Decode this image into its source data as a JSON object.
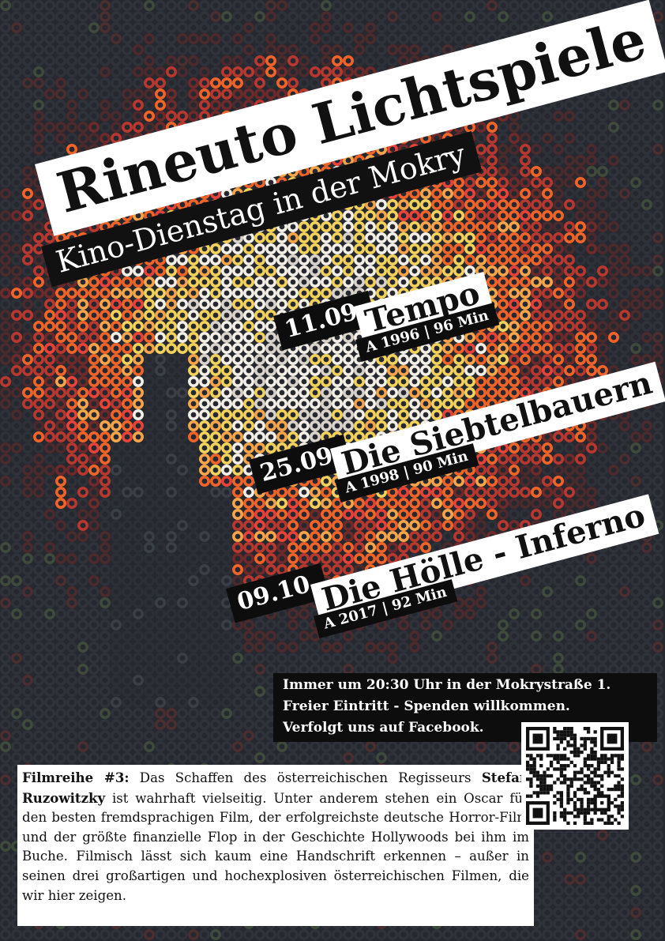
{
  "title": "Rineuto Lichtspiele",
  "subtitle": "Kino-Dienstag in der Mokry",
  "screenings": [
    {
      "date": "11.09.",
      "film": "Tempo",
      "meta": "A 1996 | 96 Min"
    },
    {
      "date": "25.09.",
      "film": "Die Siebtelbauern",
      "meta": "A 1998 | 90 Min"
    },
    {
      "date": "09.10.",
      "film": "Die Hölle - Inferno",
      "meta": "A 2017 | 92 Min"
    }
  ],
  "info_lines": [
    "Immer um 20:30 Uhr in der Mokrystraße 1.",
    "Freier Eintritt - Spenden willkommen.",
    "Verfolgt uns auf Facebook."
  ],
  "description": {
    "series_label": "Filmreihe #3:",
    "text_1": "Das Schaffen des österreichischen Regisseurs",
    "director": "Stefan Ruzowitzky",
    "text_2": "ist wahrhaft vielseitig. Unter anderem ste­hen ein Oscar für den besten fremdsprachigen Film, der erfolg­reichste deutsche Horror-Film und der größte finanzielle Flop in der Geschichte Hollywoods bei ihm im Buche. Filmisch lässt sich kaum eine Handschrift erkennen – außer in seinen drei großartigen und hochexplosiven österreichischen Filmen, die wir hier zeigen."
  },
  "qr_code": "qr-code",
  "colors": {
    "background": "#25282f",
    "fire_orange": "#f0642a",
    "fire_yellow": "#f3d25c",
    "band_dark": "#0d0d0d",
    "band_light": "#ffffff"
  }
}
